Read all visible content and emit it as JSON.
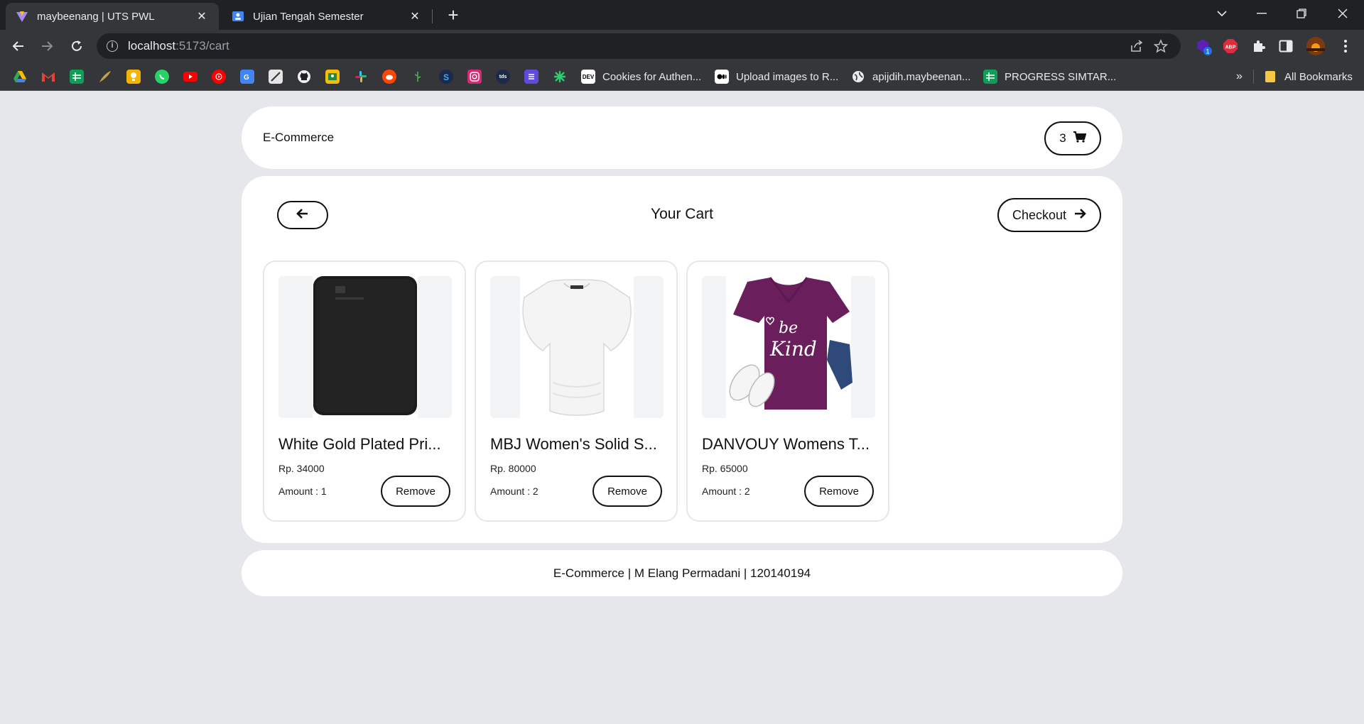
{
  "browser": {
    "tabs": [
      {
        "title": "maybeenang | UTS PWL",
        "active": true
      },
      {
        "title": "Ujian Tengah Semester",
        "active": false
      }
    ],
    "url_host": "localhost",
    "url_path": ":5173/cart",
    "extension_badge": "1",
    "abp_label": "ABP",
    "bookmarks": [
      {
        "label": "Cookies for Authen...",
        "icon": "DEV"
      },
      {
        "label": "Upload images to R...",
        "icon": "medium-icon"
      },
      {
        "label": "apijdih.maybeenan...",
        "icon": "globe-icon"
      },
      {
        "label": "PROGRESS SIMTAR...",
        "icon": "sheets-icon"
      }
    ],
    "bookmark_small_labels": {
      "dev": "DEV",
      "tds": "tds"
    },
    "bookmarks_overflow": "»",
    "all_bookmarks": "All Bookmarks"
  },
  "header": {
    "brand": "E-Commerce",
    "cart_count": "3"
  },
  "cart": {
    "title": "Your Cart",
    "checkout_label": "Checkout",
    "items": [
      {
        "name": "White Gold Plated Pri...",
        "price": "Rp. 34000",
        "amount": "Amount : 1",
        "remove_label": "Remove",
        "image": "black-external-hard-drive"
      },
      {
        "name": "MBJ Women's Solid S...",
        "price": "Rp. 80000",
        "amount": "Amount : 2",
        "remove_label": "Remove",
        "image": "white-womens-top"
      },
      {
        "name": "DANVOUY Womens T...",
        "price": "Rp. 65000",
        "amount": "Amount : 2",
        "remove_label": "Remove",
        "image": "purple-be-kind-tshirt"
      }
    ]
  },
  "footer": {
    "text": "E-Commerce | M Elang Permadani | 120140194"
  }
}
